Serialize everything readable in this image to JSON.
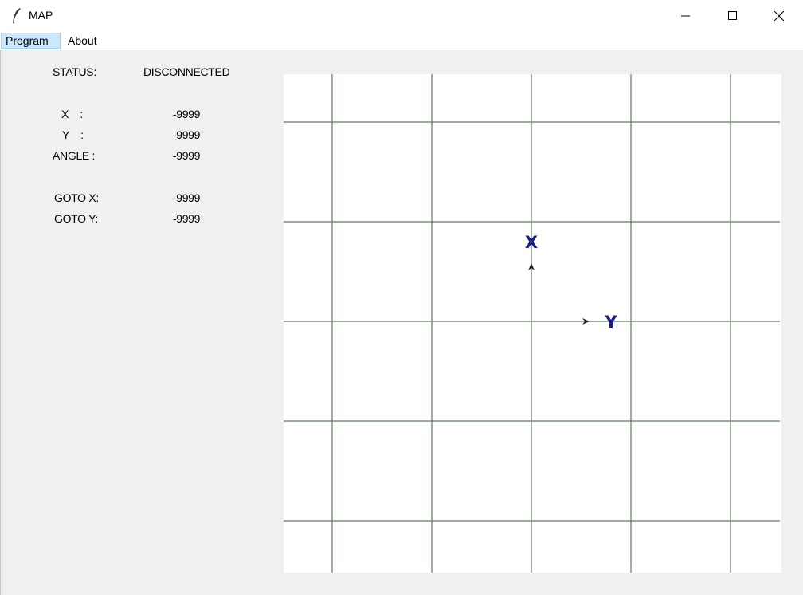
{
  "window": {
    "title": "MAP",
    "icon": "feather-icon",
    "controls": [
      "minimize-icon",
      "maximize-icon",
      "close-icon"
    ]
  },
  "menu": {
    "items": [
      {
        "label": "Program"
      },
      {
        "label": "About"
      }
    ]
  },
  "status_panel": {
    "status_label": "STATUS:",
    "status_value": "DISCONNECTED",
    "x_label": "X    :",
    "x_value": "-9999",
    "y_label": "Y    :",
    "y_value": "-9999",
    "angle_label": "ANGLE :",
    "angle_value": "-9999",
    "goto_x_label": "GOTO X:",
    "goto_x_value": "-9999",
    "goto_y_label": "GOTO Y:",
    "goto_y_value": "-9999"
  },
  "map": {
    "grid_color": "#5e7a5e",
    "axis_color": "#1a1a8a",
    "x_axis_label": "X",
    "y_axis_label": "Y"
  }
}
